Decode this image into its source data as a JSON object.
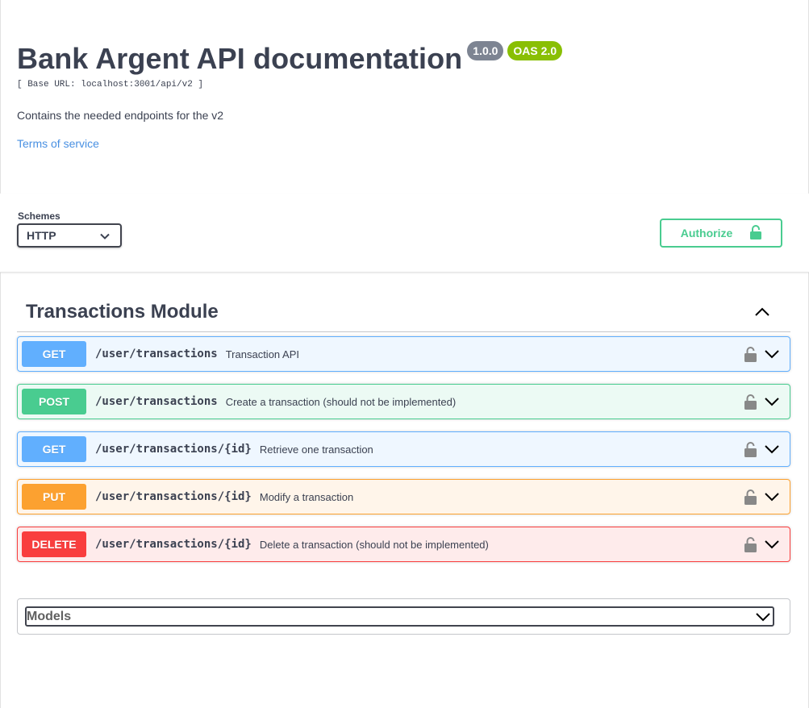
{
  "info": {
    "title": "Bank Argent API documentation",
    "version_badge": "1.0.0",
    "oas_badge": "OAS 2.0",
    "base_url": "[ Base URL: localhost:3001/api/v2 ]",
    "description": "Contains the needed endpoints for the v2",
    "terms_link": "Terms of service"
  },
  "schemes": {
    "label": "Schemes",
    "selected": "HTTP"
  },
  "authorize": {
    "label": "Authorize"
  },
  "tag": {
    "title": "Transactions Module"
  },
  "operations": [
    {
      "method": "GET",
      "path": "/user/transactions",
      "summary": "Transaction API"
    },
    {
      "method": "POST",
      "path": "/user/transactions",
      "summary": "Create a transaction (should not be implemented)"
    },
    {
      "method": "GET",
      "path": "/user/transactions/{id}",
      "summary": "Retrieve one transaction"
    },
    {
      "method": "PUT",
      "path": "/user/transactions/{id}",
      "summary": "Modify a transaction"
    },
    {
      "method": "DELETE",
      "path": "/user/transactions/{id}",
      "summary": "Delete a transaction (should not be implemented)"
    }
  ],
  "models": {
    "title": "Models"
  },
  "colors": {
    "get": "#61affe",
    "post": "#49cc90",
    "put": "#fca130",
    "delete": "#f93e3e",
    "link": "#4990e2"
  },
  "icons": {
    "lock": "lock-icon",
    "chevron_down": "chevron-down-icon",
    "chevron_up": "chevron-up-icon"
  }
}
